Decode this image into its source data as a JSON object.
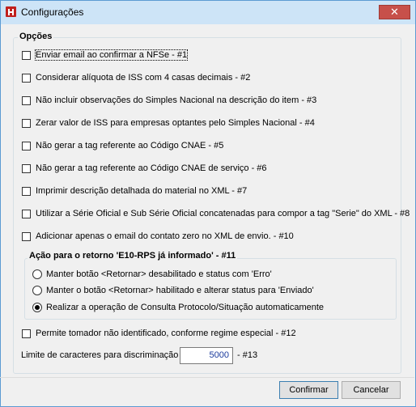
{
  "window": {
    "title": "Configurações",
    "close_glyph": "✕",
    "app_icon": "app-logo-icon"
  },
  "options_group": {
    "title": "Opções",
    "items": [
      {
        "label": "Enviar email ao confirmar a NFSe - #1",
        "checked": false
      },
      {
        "label": "Considerar alíquota de ISS com 4 casas decimais  - #2",
        "checked": false
      },
      {
        "label": "Não incluir observações do Simples Nacional na descrição do item - #3",
        "checked": false
      },
      {
        "label": "Zerar valor de ISS para empresas optantes pelo Simples Nacional  - #4",
        "checked": false
      },
      {
        "label": "Não gerar a tag referente ao Código CNAE - #5",
        "checked": false
      },
      {
        "label": "Não gerar a tag referente ao Código CNAE de serviço - #6",
        "checked": false
      },
      {
        "label": "Imprimir descrição detalhada do material no XML - #7",
        "checked": false
      },
      {
        "label": "Utilizar a Série Oficial e Sub Série Oficial concatenadas para compor a tag \"Serie\" do XML - #8",
        "checked": false
      },
      {
        "label": "Adicionar apenas o email do contato zero no XML de envio. - #10",
        "checked": false
      }
    ]
  },
  "return_group": {
    "title": "Ação para o retorno 'E10-RPS já informado' - #11",
    "options": [
      {
        "label": "Manter botão <Retornar> desabilitado e status com 'Erro'",
        "selected": false
      },
      {
        "label": "Manter o botão <Retornar> habilitado e alterar status para 'Enviado'",
        "selected": false
      },
      {
        "label": "Realizar a operação de Consulta Protocolo/Situação automaticamente",
        "selected": true
      }
    ]
  },
  "tomador": {
    "label": "Permite tomador não identificado, conforme regime especial - #12",
    "checked": false
  },
  "limit": {
    "label": "Limite de caracteres para discriminação",
    "value": "5000",
    "suffix": "- #13"
  },
  "buttons": {
    "confirm": "Confirmar",
    "cancel": "Cancelar"
  }
}
